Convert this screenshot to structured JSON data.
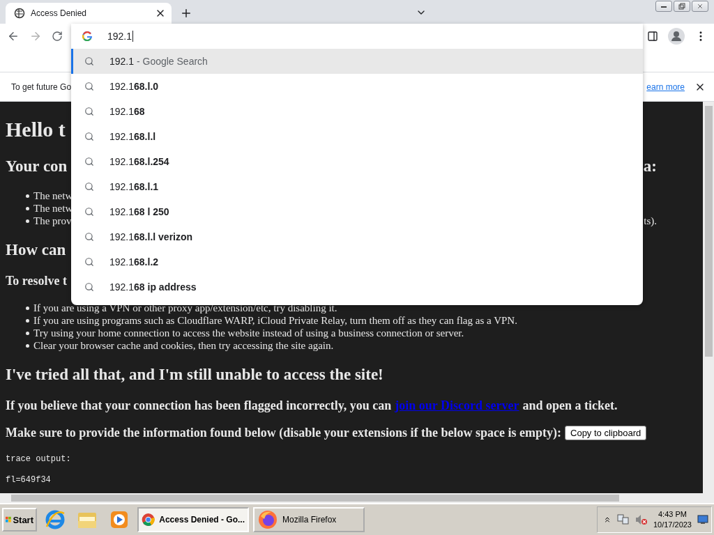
{
  "browser": {
    "tab": {
      "title": "Access Denied",
      "selected": true
    },
    "omnibox": {
      "value": "192.1"
    },
    "suggestions": [
      {
        "text": "192.1",
        "hint": "- Google Search",
        "selected": true
      },
      {
        "text": "192.1**68.l.0**",
        "selected": false
      },
      {
        "text": "192.1**68**",
        "selected": false
      },
      {
        "text": "192.1**68.l.l**",
        "selected": false
      },
      {
        "text": "192.1**68.l.254**",
        "selected": false
      },
      {
        "text": "192.1**68.l.1**",
        "selected": false
      },
      {
        "text": "192.1**68 l 250**",
        "selected": false
      },
      {
        "text": "192.1**68.l.l verizon**",
        "selected": false
      },
      {
        "text": "192.1**68.l.2**",
        "selected": false
      },
      {
        "text": "192.1**68 ip address**",
        "selected": false
      }
    ]
  },
  "infobar": {
    "text": "To get future Go",
    "link": "earn more"
  },
  "page": [
    {
      "kind": "h1",
      "text": "Hello t"
    },
    {
      "kind": "h2",
      "text": "Your con",
      "tail": "a:"
    },
    {
      "kind": "list",
      "items": [
        {
          "text": "The netw"
        },
        {
          "text": "The netw"
        },
        {
          "text": "The prov",
          "tail": "ts)."
        }
      ]
    },
    {
      "kind": "h2",
      "text": "How can"
    },
    {
      "kind": "h3",
      "text": "To resolve t"
    },
    {
      "kind": "list",
      "items": [
        {
          "text": "If you are using a VPN or other proxy app/extension/etc, try disabling it."
        },
        {
          "text": "If you are using programs such as Cloudflare WARP, iCloud Private Relay, turn them off as they can flag as a VPN."
        },
        {
          "text": "Try using your home connection to access the website instead of using a business connection or server."
        },
        {
          "text": "Clear your browser cache and cookies, then try accessing the site again."
        }
      ]
    },
    {
      "kind": "h2",
      "text": "I've tried all that, and I'm still unable to access the site!"
    },
    {
      "kind": "link_para",
      "text": "If you believe that your connection has been flagged incorrectly, you can",
      "link": "join our Discord server",
      "after": "and open a ticket."
    },
    {
      "kind": "button_para",
      "text": "Make sure to provide the information found below (disable your extensions if the below space is empty):",
      "button": "Copy to clipboard"
    },
    {
      "kind": "pre",
      "lines": [
        "trace output:",
        "fl=649f34"
      ]
    }
  ],
  "taskbar": {
    "start": "Start",
    "tasks": [
      {
        "kind": "chrome",
        "label": "Access Denied - Go...",
        "selected": true
      },
      {
        "kind": "firefox",
        "label": "Mozilla Firefox",
        "selected": false
      }
    ],
    "time": "4:43 PM",
    "date": "10/17/2023"
  }
}
